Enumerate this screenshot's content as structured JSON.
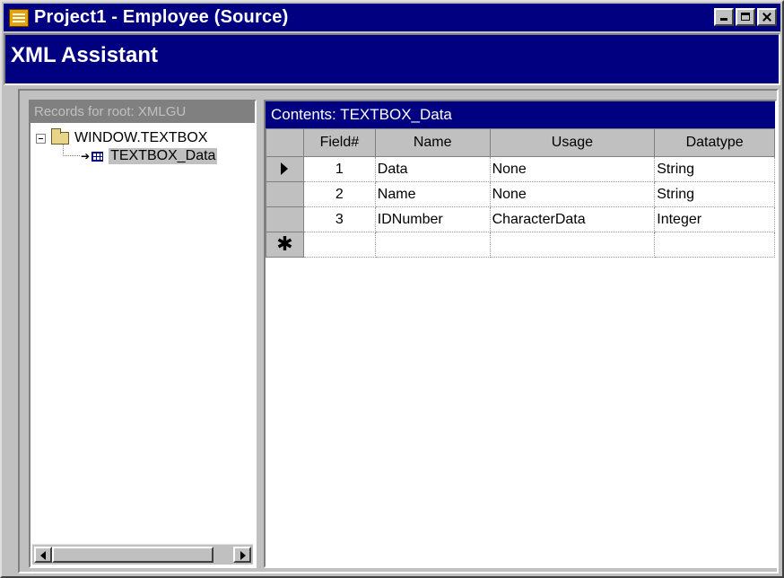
{
  "window": {
    "title": "Project1 - Employee (Source)",
    "icon": "app-icon"
  },
  "banner": {
    "title": "XML Assistant"
  },
  "tree": {
    "header": "Records for root: XMLGU",
    "root_label": "WINDOW.TEXTBOX",
    "child_label": "TEXTBOX_Data"
  },
  "contents": {
    "header": "Contents: TEXTBOX_Data",
    "columns": [
      "Field#",
      "Name",
      "Usage",
      "Datatype"
    ],
    "rows": [
      {
        "field": "1",
        "name": "Data",
        "usage": "None",
        "datatype": "String"
      },
      {
        "field": "2",
        "name": "Name",
        "usage": "None",
        "datatype": "String"
      },
      {
        "field": "3",
        "name": "IDNumber",
        "usage": "CharacterData",
        "datatype": "Integer"
      }
    ],
    "new_row_marker": "✱"
  },
  "colors": {
    "title_bar": "#000080",
    "face": "#c0c0c0"
  }
}
